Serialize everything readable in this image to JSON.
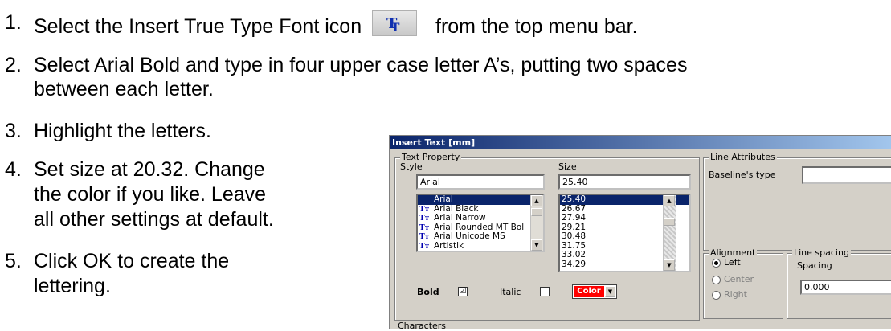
{
  "steps": [
    {
      "num": "1.",
      "text": "Select the Insert True Type Font icon",
      "text_after": "from the top menu bar."
    },
    {
      "num": "2.",
      "text": "Select Arial Bold and type in four upper case letter A’s, putting two spaces",
      "text2": "between each letter."
    },
    {
      "num": "3.",
      "text": "Highlight the letters."
    },
    {
      "num": "4.",
      "text": "Set size at 20.32.  Change",
      "text2": "the color if you like.  Leave",
      "text3": "all other settings at default."
    },
    {
      "num": "5.",
      "text": "Click OK to create the",
      "text2": "lettering."
    }
  ],
  "dialog": {
    "title": "Insert Text  [mm]",
    "text_property_label": "Text Property",
    "style_label": "Style",
    "size_label": "Size",
    "style_value": "Arial",
    "size_value": "25.40",
    "fonts": [
      "Arial",
      "Arial Black",
      "Arial Narrow",
      "Arial Rounded MT Bol",
      "Arial Unicode MS",
      "Artistik"
    ],
    "sizes": [
      "25.40",
      "26.67",
      "27.94",
      "29.21",
      "30.48",
      "31.75",
      "33.02",
      "34.29"
    ],
    "selected_font": "Arial",
    "selected_size": "25.40",
    "bold_label": "Bold",
    "bold_checked": "☑",
    "italic_label": "Italic",
    "color_label": "Color",
    "color_value": "#ff0000",
    "line_attributes_label": "Line Attributes",
    "baseline_label": "Baseline's type",
    "alignment_label": "Alignment",
    "align_left": "Left",
    "align_center": "Center",
    "align_right": "Right",
    "line_spacing_label": "Line spacing",
    "spacing_label": "Spacing",
    "spacing_value": "0.000",
    "characters_label": "Characters"
  },
  "icons": {
    "insert_truetype": "truetype-font-icon"
  }
}
